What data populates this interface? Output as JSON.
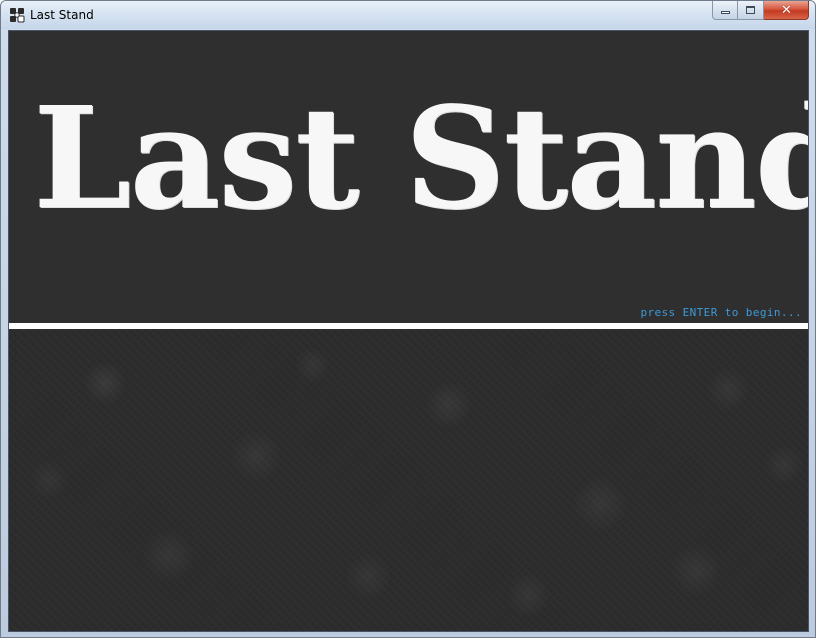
{
  "window": {
    "title": "Last Stand",
    "icon": "game-controller-icon"
  },
  "caption_buttons": {
    "minimize_icon": "minimize-icon",
    "maximize_icon": "maximize-icon",
    "close_icon": "close-icon",
    "close_glyph": "✕"
  },
  "game": {
    "title": "Last Stand",
    "prompt": "press ENTER to begin..."
  },
  "colors": {
    "background": "#2e2e2e",
    "title_text": "#f7f7f7",
    "prompt_text": "#3d9ad8",
    "divider": "#ffffff",
    "close_button": "#c33b21"
  }
}
